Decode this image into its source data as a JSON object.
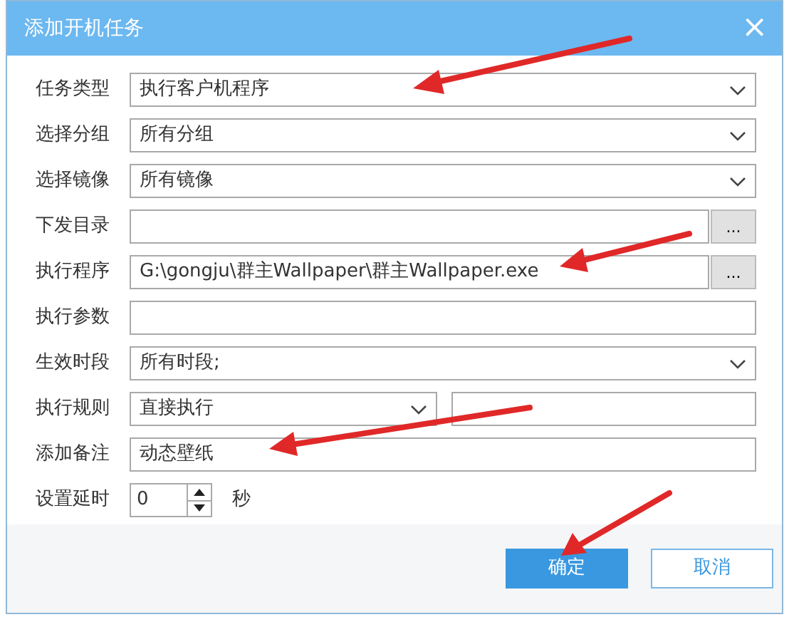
{
  "window": {
    "title": "添加开机任务",
    "close": "×"
  },
  "fields": [
    {
      "kind": "select",
      "label": "任务类型",
      "value": "执行客户机程序"
    },
    {
      "kind": "select",
      "label": "选择分组",
      "value": "所有分组"
    },
    {
      "kind": "select",
      "label": "选择镜像",
      "value": "所有镜像"
    },
    {
      "kind": "browse",
      "label": "下发目录",
      "button": "..."
    },
    {
      "kind": "browse",
      "label": "执行程序",
      "value": "G:\\gongju\\群主Wallpaper\\群主Wallpaper.exe",
      "button": "..."
    },
    {
      "kind": "text",
      "label": "执行参数"
    },
    {
      "kind": "select",
      "label": "生效时段",
      "value": "所有时段;"
    },
    {
      "kind": "rule",
      "label": "执行规则",
      "value": "直接执行"
    },
    {
      "kind": "text",
      "label": "添加备注",
      "value": "动态壁纸"
    },
    {
      "kind": "spin",
      "label": "设置延时",
      "value": "0",
      "unit": "秒"
    }
  ],
  "buttons": [
    {
      "label": "确定",
      "primary": true
    },
    {
      "label": "取消",
      "primary": false
    }
  ]
}
